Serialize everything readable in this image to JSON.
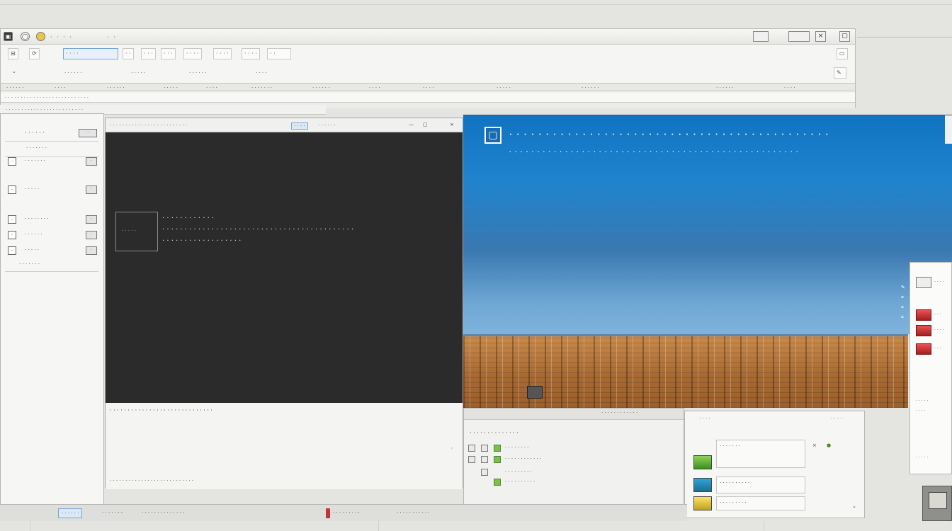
{
  "back_window": {
    "title_tabs": [
      "· · · ·",
      "· ·"
    ],
    "window_controls": [
      "",
      "",
      "×"
    ],
    "toolbar_buttons": [
      "· · · ·",
      "· ·",
      "· · ·",
      "· · ·",
      "· · · ·",
      "· · · ·",
      "· · · ·",
      "· ·"
    ],
    "toolbar_row2": [
      "· · · · · ·",
      "· · · · ·",
      "· · · · ·  ·",
      "· ·  · ·"
    ],
    "ribbon_labels": [
      "· · · · · ·",
      "· · · ·",
      "· · · · · ·",
      "· · · · ·",
      "· · · ·",
      "· · · · · · ·",
      "· · · · · ·",
      "· · · ·",
      "· · · ·",
      "· · · · ·",
      "· · · · · ·",
      "· · · · · ·",
      "· · · ·"
    ],
    "menu_band_text": [
      "· · · · · · · ·  · · ·  · · · · ·  · · · · ·  · · · · · ·"
    ],
    "breadcrumb_text": "· · · · · · · ·  ·  · · · · · · ·  · · · · · · · · ·"
  },
  "left_panel": {
    "header_label": "· · · · · ·",
    "header_chip": "· ·",
    "filter_text": "· · ·  · · · ·",
    "rows": [
      {
        "icon": "·",
        "label": "· · · · · · ·",
        "chip": "·"
      },
      {
        "icon": "·",
        "label": "· · · · ·",
        "chip": "·"
      },
      {
        "icon": "·",
        "label": "· · · · · · · ·",
        "chip": "·"
      },
      {
        "icon": "·",
        "label": "· · · · · ·",
        "chip": "·"
      },
      {
        "icon": "·",
        "label": "· · · · ·",
        "chip": "·"
      }
    ],
    "footer_label": "· · · · · · ·"
  },
  "console": {
    "title_text": "· · · · · · · ·  · · · · · · ·  · · · · · · · · · ·",
    "title_tab": "· · · ·",
    "title_right": "· · · ·  · ·",
    "thumb_text": "· · · · ·",
    "lines": [
      "· · · · ·  · · · · · · ·",
      "· · · · · · · · · · · · · · ·  · · · · · · ·  · · · · · ·  · · · · · ·  · · · · · · · · ·",
      "· · ·  · · · · · · · · · ·  · · · · ·"
    ],
    "status_text": "· · · · · · · · ·  · · · · · · · ·  · · ·  · · · · ·  · · · ·",
    "bottom_icons": "· · ·  · · ·  · · ·  · · ·  · · ·  · · ·  · · ·  · · ·  · · ·",
    "scroll_mark": "·"
  },
  "banner": {
    "logo": "▢",
    "title": "· · · · · · · · · ·  · · · · · ·  · · · · · ·  · · · · · · · · · · ·  · · · · · · · · · · ·",
    "subtitle": "· · · ·  · · · · · · · · · ·  · · · · ·  · · · · · · ·  · · · · ·  · · · · · · · · · ·  · · · · · · · · · · ·"
  },
  "mid_panel": {
    "heading": "· · · · · · · ·  · · · · · ·",
    "rows": [
      "· · · · · · · ·",
      "· · · · · · · · · · · ·",
      "· · · · · · · · ·",
      "· · · · · · · ·  · ·"
    ],
    "side_text": "· · · · · · · ·  · · · ·"
  },
  "right_panel": {
    "header_items": [
      "· · · ·",
      "· · · ·"
    ],
    "boxes": [
      {
        "text": "· · · · · · ·"
      },
      {
        "text": "· · · · · · · · · ·"
      },
      {
        "text": "· · · · · · · · ·"
      }
    ]
  },
  "far_panel": {
    "items": [
      "· · · ·",
      "· · ·",
      "· · · ·",
      "· · ·",
      "· · · · ·",
      "· · · ·",
      "· · · · ·"
    ]
  },
  "taskbar": {
    "items": [
      "· · · · · ·",
      "· · · · · · ·",
      "· · · · · · · · · · · · · ·",
      "· · · · · · · · ·",
      "· · · · · · · · · · ·"
    ]
  },
  "colors": {
    "banner_blue": "#1173c2",
    "console_dark": "#2b2b2b",
    "wood": "#a86a33",
    "accent_green": "#7cc04a",
    "accent_red": "#c43636"
  },
  "icons": [
    "window-menu-icon",
    "refresh-icon",
    "home-icon",
    "close-icon",
    "shield-icon",
    "device-icon"
  ]
}
